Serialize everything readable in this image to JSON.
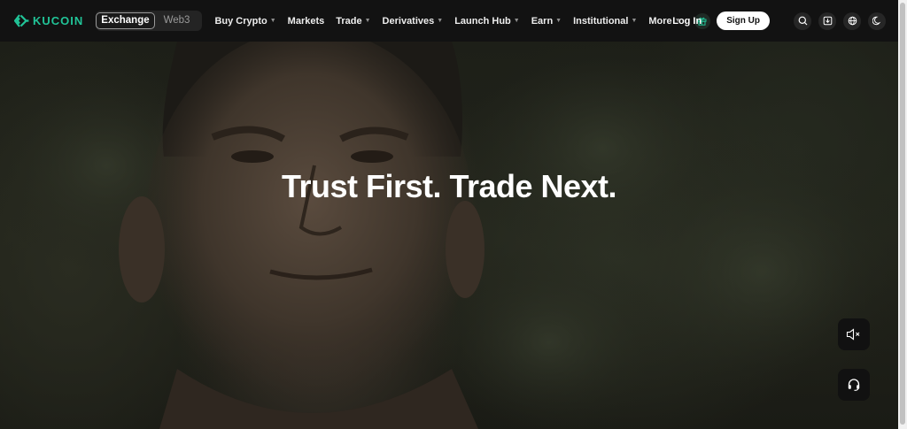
{
  "brand": {
    "name": "KUCOIN",
    "accent": "#21c397"
  },
  "mode_switch": {
    "active": "Exchange",
    "inactive": "Web3"
  },
  "nav": [
    {
      "label": "Buy Crypto",
      "dropdown": true
    },
    {
      "label": "Markets",
      "dropdown": false
    },
    {
      "label": "Trade",
      "dropdown": true
    },
    {
      "label": "Derivatives",
      "dropdown": true
    },
    {
      "label": "Launch Hub",
      "dropdown": true
    },
    {
      "label": "Earn",
      "dropdown": true
    },
    {
      "label": "Institutional",
      "dropdown": true
    },
    {
      "label": "More",
      "dropdown": true
    }
  ],
  "auth": {
    "login": "Log In",
    "signup": "Sign Up"
  },
  "header_icons": [
    "search-icon",
    "download-icon",
    "globe-icon",
    "moon-icon"
  ],
  "hero": {
    "title": "Trust First. Trade Next."
  },
  "floating": {
    "mute_icon": "speaker-mute-icon",
    "support_icon": "headset-icon"
  }
}
